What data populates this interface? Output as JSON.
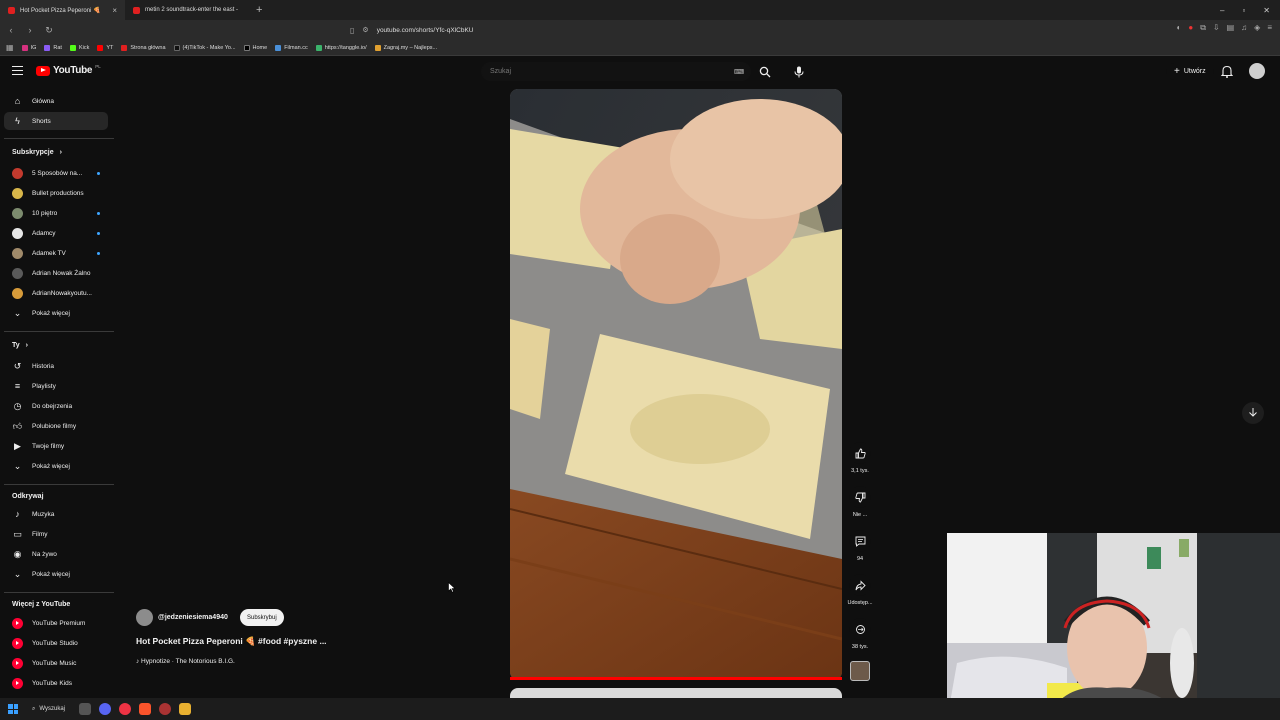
{
  "browser": {
    "tabs": [
      {
        "label": "Hot Pocket Pizza Peperoni 🍕",
        "active": true
      },
      {
        "label": "metin 2 soundtrack-enter the east -",
        "active": false
      }
    ],
    "url": "youtube.com/shorts/Yfc-qXlCbKU",
    "bookmarks": [
      "IG",
      "Rat",
      "Kick",
      "YT",
      "Strona główna",
      "(4)TikTok - Make Yo...",
      "Home",
      "Filman.cc",
      "https://tanggle.io/",
      "Zagraj.my – Najleps..."
    ]
  },
  "header": {
    "logo_text": "YouTube",
    "logo_country": "PL",
    "search_placeholder": "Szukaj",
    "create_label": "Utwórz"
  },
  "sidebar": {
    "main": [
      {
        "label": "Główna",
        "icon": "home-icon"
      },
      {
        "label": "Shorts",
        "icon": "shorts-icon",
        "active": true
      }
    ],
    "subs_heading": "Subskrypcje",
    "subscriptions": [
      {
        "label": "5 Sposobów na...",
        "color": "#c33a2e",
        "live": true
      },
      {
        "label": "Bullet productions",
        "color": "#d8b64a",
        "live": false
      },
      {
        "label": "10 piętro",
        "color": "#7c8b6e",
        "live": true
      },
      {
        "label": "Adamcy",
        "color": "#e6e6e6",
        "live": true
      },
      {
        "label": "Adamek TV",
        "color": "#a08a6a",
        "live": true
      },
      {
        "label": "Adrian Nowak Żalno",
        "color": "#5a5a5a",
        "live": false
      },
      {
        "label": "AdrianNowakyoutu...",
        "color": "#d79b3a",
        "live": false
      }
    ],
    "subs_more": "Pokaż więcej",
    "you_heading": "Ty",
    "you_items": [
      {
        "label": "Historia",
        "icon": "history-icon"
      },
      {
        "label": "Playlisty",
        "icon": "playlists-icon"
      },
      {
        "label": "Do obejrzenia",
        "icon": "watch-later-icon"
      },
      {
        "label": "Polubione filmy",
        "icon": "liked-icon"
      },
      {
        "label": "Twoje filmy",
        "icon": "your-videos-icon"
      }
    ],
    "you_more": "Pokaż więcej",
    "explore_heading": "Odkrywaj",
    "explore_items": [
      {
        "label": "Muzyka",
        "icon": "music-icon"
      },
      {
        "label": "Filmy",
        "icon": "movies-icon"
      },
      {
        "label": "Na żywo",
        "icon": "live-icon"
      }
    ],
    "explore_more": "Pokaż więcej",
    "more_heading": "Więcej z YouTube",
    "more_items": [
      {
        "label": "YouTube Premium"
      },
      {
        "label": "YouTube Studio"
      },
      {
        "label": "YouTube Music"
      },
      {
        "label": "YouTube Kids"
      }
    ]
  },
  "video": {
    "channel": "@jedzeniesiema4940",
    "subscribe_label": "Subskrybuj",
    "title": "Hot Pocket Pizza Peperoni 🍕 #food #pyszne ...",
    "music": "♪ Hypnotize · The Notorious B.I.G.",
    "likes": "3,1 tys.",
    "dislike_label": "Nie ...",
    "comments": "94",
    "share_label": "Udostęp...",
    "remix_count": "38 tys.",
    "progress_percent": 100
  },
  "taskbar": {
    "search_label": "Wyszukaj"
  }
}
